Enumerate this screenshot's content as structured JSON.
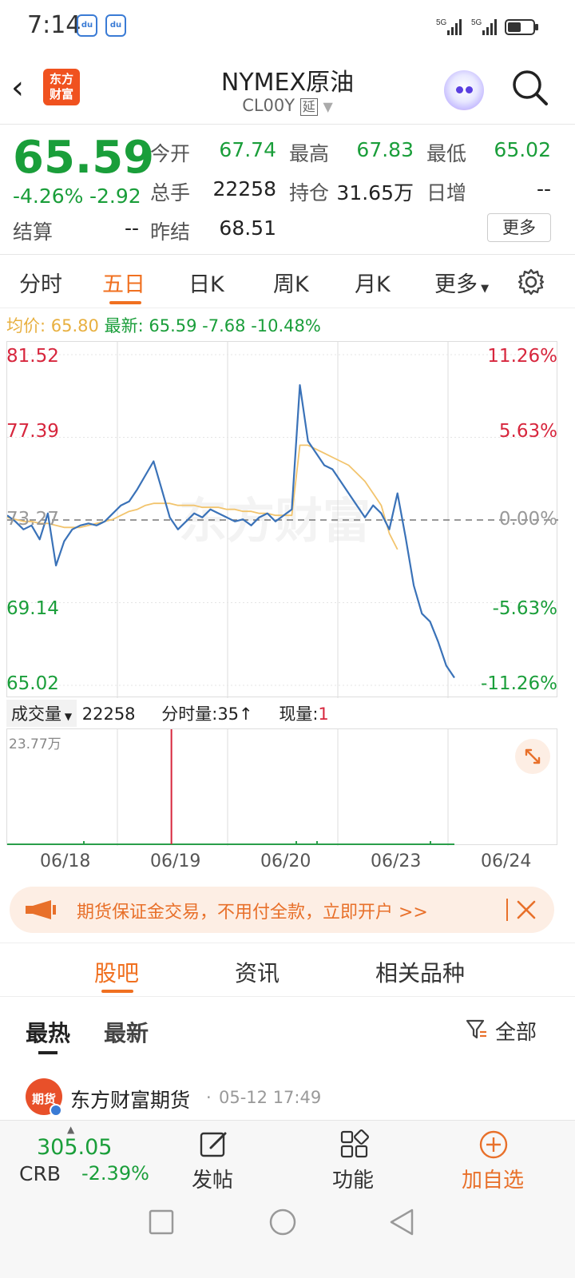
{
  "status_bar": {
    "time": "7:14",
    "app_icon": "baidu-app-icon",
    "battery_icon": "battery-icon",
    "signal_label": "5G"
  },
  "header": {
    "title": "NYMEX原油",
    "subtitle": "CL00Y",
    "delay_badge": "延",
    "logo_text_1": "东方",
    "logo_text_2": "财富"
  },
  "quote": {
    "price": "65.59",
    "change_pct": "-4.26%",
    "change": "-2.92",
    "open_label": "今开",
    "open": "67.74",
    "high_label": "最高",
    "high": "67.83",
    "low_label": "最低",
    "low": "65.02",
    "volume_label": "总手",
    "volume": "22258",
    "oi_label": "持仓",
    "oi": "31.65万",
    "daily_inc_label": "日增",
    "daily_inc": "--",
    "settle_label": "结算",
    "settle": "--",
    "prev_settle_label": "昨结",
    "prev_settle": "68.51",
    "more_label": "更多"
  },
  "tabs": [
    "分时",
    "五日",
    "日K",
    "周K",
    "月K",
    "更多"
  ],
  "info_line": {
    "avg_label": "均价:",
    "avg": "65.80",
    "last_label": "最新:",
    "last": "65.59",
    "chg": "-7.68",
    "pct": "-10.48%"
  },
  "chart_data": {
    "type": "line",
    "y_left_ticks": [
      "81.52",
      "77.39",
      "73.27",
      "69.14",
      "65.02"
    ],
    "y_right_ticks": [
      "11.26%",
      "5.63%",
      "0.00%",
      "-5.63%",
      "-11.26%"
    ],
    "x_labels": [
      "06/18",
      "06/19",
      "06/20",
      "06/23",
      "06/24"
    ],
    "ylim": [
      65.02,
      81.52
    ],
    "reference": 73.27,
    "watermark": "东方财富",
    "series": [
      {
        "name": "最新",
        "color": "#3a72b8",
        "values": [
          73.5,
          73.2,
          72.8,
          73.0,
          72.3,
          73.6,
          71.0,
          72.2,
          72.8,
          73.0,
          73.1,
          73.0,
          73.2,
          73.6,
          74.0,
          74.2,
          74.8,
          75.5,
          76.2,
          74.8,
          73.4,
          72.8,
          73.2,
          73.6,
          73.4,
          73.8,
          73.6,
          73.4,
          73.2,
          73.3,
          73.0,
          73.4,
          73.6,
          73.2,
          73.5,
          73.8,
          80.0,
          77.2,
          76.6,
          76.0,
          75.8,
          75.2,
          74.6,
          74.0,
          73.4,
          74.0,
          73.6,
          72.8,
          74.6,
          72.4,
          70.0,
          68.6,
          68.2,
          67.2,
          66.0,
          65.4
        ]
      },
      {
        "name": "均价",
        "color": "#f2c46d",
        "values": [
          73.4,
          73.3,
          73.2,
          73.2,
          73.1,
          73.1,
          73.0,
          72.9,
          72.9,
          72.9,
          73.0,
          73.1,
          73.2,
          73.3,
          73.5,
          73.7,
          73.8,
          74.0,
          74.1,
          74.1,
          74.1,
          74.0,
          74.0,
          74.0,
          73.9,
          73.9,
          73.9,
          73.8,
          73.8,
          73.7,
          73.7,
          73.6,
          73.6,
          73.5,
          73.5,
          73.5,
          77.0,
          77.0,
          76.8,
          76.6,
          76.4,
          76.2,
          76.0,
          75.6,
          75.2,
          74.6,
          74.0,
          72.6,
          71.8,
          null,
          null,
          null,
          null,
          null,
          null,
          null
        ]
      }
    ]
  },
  "volume": {
    "label": "成交量",
    "total": "22258",
    "tick_label": "分时量:",
    "tick_value": "35",
    "now_label": "现量:",
    "now_value": "1",
    "ymax": "23.77万",
    "spike_index": 20
  },
  "promo": {
    "text": "期货保证金交易，不用付全款，立即开户 >>"
  },
  "section_tabs": [
    "股吧",
    "资讯",
    "相关品种"
  ],
  "sort": {
    "hot": "最热",
    "new": "最新",
    "filter": "全部"
  },
  "post": {
    "author": "东方财富期货",
    "time": "05-12 17:49",
    "avatar_text": "期货"
  },
  "bottom": {
    "crb_value": "305.05",
    "crb_label": "CRB",
    "crb_pct": "-2.39%",
    "post_label": "发帖",
    "func_label": "功能",
    "add_label": "加自选"
  }
}
